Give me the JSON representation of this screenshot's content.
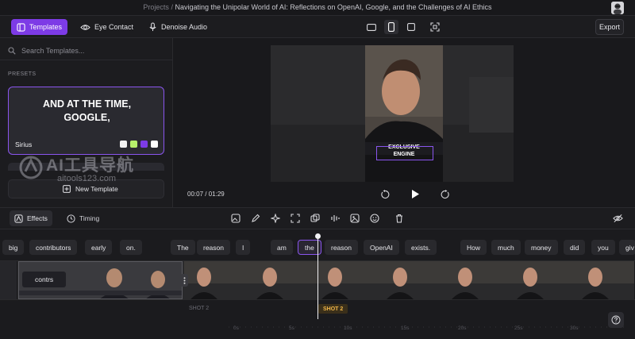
{
  "header": {
    "breadcrumb_root": "Projects",
    "separator": "/",
    "project_title": "Navigating the Unipolar World of AI: Reflections on OpenAI, Google, and the Challenges of AI Ethics"
  },
  "toolbar": {
    "templates_label": "Templates",
    "eye_contact_label": "Eye Contact",
    "denoise_label": "Denoise Audio",
    "export_label": "Export",
    "accent": "#7d3be6"
  },
  "left_panel": {
    "search_placeholder": "Search Templates...",
    "presets_heading": "PRESETS",
    "preset": {
      "preview_line1": "AND AT THE TIME,",
      "preview_line2": "GOOGLE,",
      "name": "Sirius",
      "swatches": [
        "#f2f2f2",
        "#b6f06a",
        "#7d3be6",
        "#ffffff"
      ]
    },
    "new_template_label": "New Template"
  },
  "watermark": {
    "title": "AI工具导航",
    "url": "aitools123.com"
  },
  "preview": {
    "time_current": "00:07",
    "time_separator": "/",
    "time_total": "01:29",
    "caption_line1": "EXCLUSIVE",
    "caption_line2": "ENGINE"
  },
  "bottom_bar": {
    "effects_label": "Effects",
    "timing_label": "Timing"
  },
  "transcript": {
    "words": [
      "big",
      "contributors",
      "early",
      "on.",
      "The",
      "reason",
      "I",
      "am",
      "the",
      "reason",
      "OpenAI",
      "exists.",
      "How",
      "much",
      "money",
      "did",
      "you",
      "giv"
    ],
    "active_index": 8
  },
  "timeline": {
    "clip_label": "contrs",
    "shot_label_prev": "SHOT 2",
    "shot_label_current": "SHOT 2",
    "ruler_ticks": [
      "0s",
      "5s",
      "10s",
      "15s",
      "20s",
      "25s",
      "30s"
    ]
  }
}
